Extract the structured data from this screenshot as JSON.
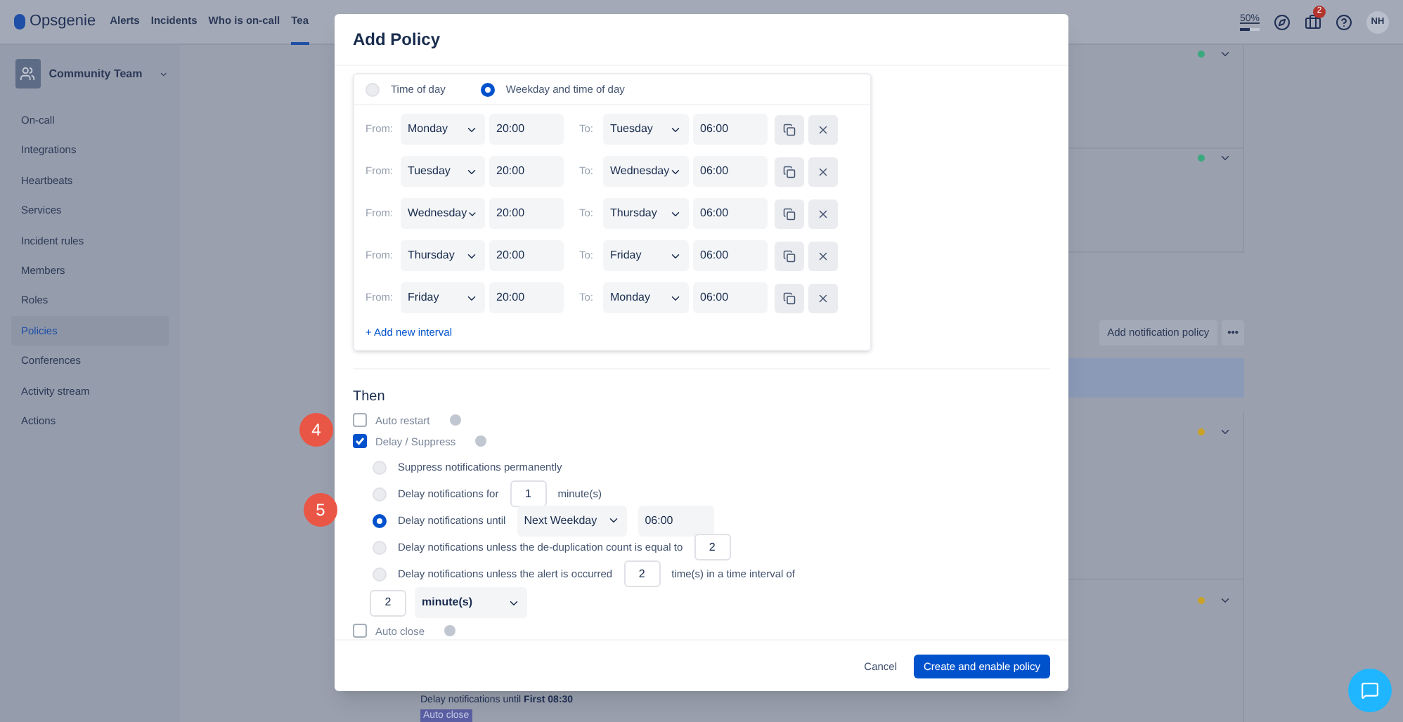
{
  "top_nav": {
    "logo": "Opsgenie",
    "links": [
      {
        "label": "Alerts",
        "selected": false
      },
      {
        "label": "Incidents",
        "selected": false
      },
      {
        "label": "Who is on-call",
        "selected": false
      },
      {
        "label": "Tea",
        "selected": true
      }
    ],
    "usage": {
      "label": "50%",
      "level": 0.5
    },
    "notification_count": "2",
    "avatar": "NH"
  },
  "sidebar": {
    "team": "Community Team",
    "items": [
      {
        "label": "On-call",
        "selected": false
      },
      {
        "label": "Integrations",
        "selected": false
      },
      {
        "label": "Heartbeats",
        "selected": false
      },
      {
        "label": "Services",
        "selected": false
      },
      {
        "label": "Incident rules",
        "selected": false
      },
      {
        "label": "Members",
        "selected": false
      },
      {
        "label": "Roles",
        "selected": false
      },
      {
        "label": "Policies",
        "selected": true
      },
      {
        "label": "Conferences",
        "selected": false
      },
      {
        "label": "Activity stream",
        "selected": false
      },
      {
        "label": "Actions",
        "selected": false
      }
    ]
  },
  "background": {
    "upper_cards": [
      {
        "color": "#3aa97e"
      },
      {
        "color": "#3aa97e"
      }
    ],
    "add_button": "Add notification policy",
    "more_button": "•••",
    "lower_cards": [
      {
        "color": "#c9a227"
      },
      {
        "color": "#c9a227"
      }
    ],
    "footer_text": "Delay notifications until **First 08:30**",
    "tag": "Auto close"
  },
  "modal": {
    "title": "Add Policy",
    "time_modes": [
      {
        "label": "Time of day",
        "selected": false
      },
      {
        "label": "Weekday and time of day",
        "selected": true
      }
    ],
    "intervals": [
      {
        "from_label": "From:",
        "from_day": "Monday",
        "from_time": "20:00",
        "to_label": "To:",
        "to_day": "Tuesday",
        "to_time": "06:00"
      },
      {
        "from_label": "From:",
        "from_day": "Tuesday",
        "from_time": "20:00",
        "to_label": "To:",
        "to_day": "Wednesday",
        "to_time": "06:00"
      },
      {
        "from_label": "From:",
        "from_day": "Wednesday",
        "from_time": "20:00",
        "to_label": "To:",
        "to_day": "Thursday",
        "to_time": "06:00"
      },
      {
        "from_label": "From:",
        "from_day": "Thursday",
        "from_time": "20:00",
        "to_label": "To:",
        "to_day": "Friday",
        "to_time": "06:00"
      },
      {
        "from_label": "From:",
        "from_day": "Friday",
        "from_time": "20:00",
        "to_label": "To:",
        "to_day": "Monday",
        "to_time": "06:00"
      }
    ],
    "add_interval": "+ Add new interval",
    "then_heading": "Then",
    "actions": [
      {
        "label": "Auto restart",
        "checked": false
      },
      {
        "label": "Delay / Suppress",
        "checked": true,
        "options": [
          {
            "kind": "plain",
            "label": "Suppress notifications permanently",
            "selected": false
          },
          {
            "kind": "for",
            "label": "Delay notifications for",
            "value": "1",
            "unit": "minute(s)",
            "selected": false
          },
          {
            "kind": "until",
            "label": "Delay notifications until",
            "day": "Next Weekday",
            "time": "06:00",
            "selected": true
          },
          {
            "kind": "count",
            "label": "Delay notifications unless the de-duplication count is equal to",
            "value": "2",
            "selected": false
          },
          {
            "kind": "occurrence",
            "label": "Delay notifications unless the alert is occurred",
            "value": "2",
            "suffix": "time(s) in a time interval of",
            "interval": "2",
            "unit": "minute(s)",
            "selected": false
          }
        ]
      },
      {
        "label": "Auto close",
        "checked": false
      }
    ],
    "cancel": "Cancel",
    "submit": "Create and enable policy"
  },
  "annotations": [
    "4",
    "5"
  ]
}
